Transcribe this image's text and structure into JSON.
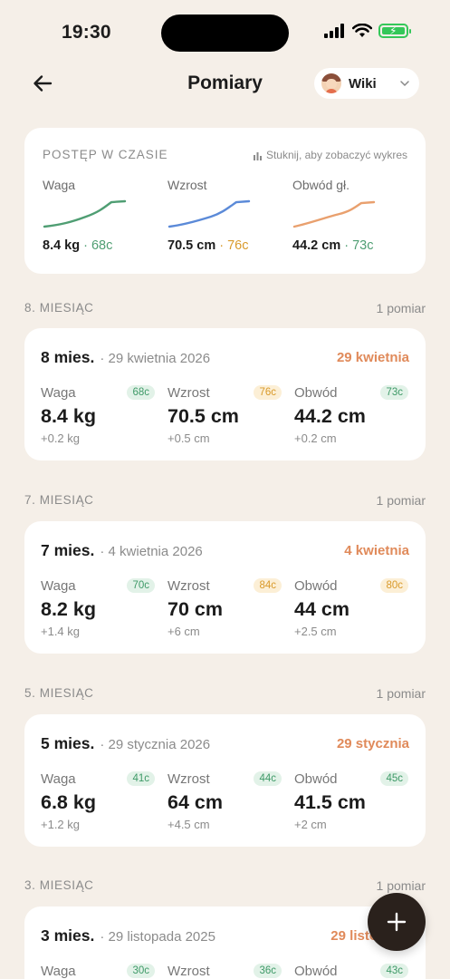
{
  "status_bar": {
    "time": "19:30"
  },
  "header": {
    "title": "Pomiary",
    "child_name": "Wiki"
  },
  "progress": {
    "title": "POSTĘP W CZASIE",
    "hint": "Stuknij, aby zobaczyć wykres",
    "metrics": [
      {
        "label": "Waga",
        "value": "8.4 kg",
        "percentile": " · 68c",
        "color": "#4f9e73"
      },
      {
        "label": "Wzrost",
        "value": "70.5 cm",
        "percentile": " · 76c",
        "color": "#5b8ad8"
      },
      {
        "label": "Obwód gł.",
        "value": "44.2 cm",
        "percentile": " · 73c",
        "color": "#e9a06e"
      }
    ]
  },
  "sections": [
    {
      "title": "8. MIESIĄC",
      "count": "1 pomiar",
      "card": {
        "age": "8 mies.",
        "date": "· 29 kwietnia 2026",
        "right_date": "29 kwietnia",
        "cols": [
          {
            "label": "Waga",
            "badge": "68c",
            "value": "8.4 kg",
            "delta": "+0.2 kg"
          },
          {
            "label": "Wzrost",
            "badge": "76c",
            "value": "70.5 cm",
            "delta": "+0.5 cm"
          },
          {
            "label": "Obwód",
            "badge": "73c",
            "value": "44.2 cm",
            "delta": "+0.2 cm"
          }
        ]
      }
    },
    {
      "title": "7. MIESIĄC",
      "count": "1 pomiar",
      "card": {
        "age": "7 mies.",
        "date": "· 4 kwietnia 2026",
        "right_date": "4 kwietnia",
        "cols": [
          {
            "label": "Waga",
            "badge": "70c",
            "value": "8.2 kg",
            "delta": "+1.4 kg"
          },
          {
            "label": "Wzrost",
            "badge": "84c",
            "value": "70 cm",
            "delta": "+6 cm"
          },
          {
            "label": "Obwód",
            "badge": "80c",
            "value": "44 cm",
            "delta": "+2.5 cm"
          }
        ]
      }
    },
    {
      "title": "5. MIESIĄC",
      "count": "1 pomiar",
      "card": {
        "age": "5 mies.",
        "date": "· 29 stycznia 2026",
        "right_date": "29 stycznia",
        "cols": [
          {
            "label": "Waga",
            "badge": "41c",
            "value": "6.8 kg",
            "delta": "+1.2 kg"
          },
          {
            "label": "Wzrost",
            "badge": "44c",
            "value": "64 cm",
            "delta": "+4.5 cm"
          },
          {
            "label": "Obwód",
            "badge": "45c",
            "value": "41.5 cm",
            "delta": "+2 cm"
          }
        ]
      }
    },
    {
      "title": "3. MIESIĄC",
      "count": "1 pomiar",
      "card": {
        "age": "3 mies.",
        "date": "· 29 listopada 2025",
        "right_date": "29 listopada",
        "cols": [
          {
            "label": "Waga",
            "badge": "30c"
          },
          {
            "label": "Wzrost",
            "badge": "36c"
          },
          {
            "label": "Obwód",
            "badge": "43c"
          }
        ]
      }
    }
  ]
}
